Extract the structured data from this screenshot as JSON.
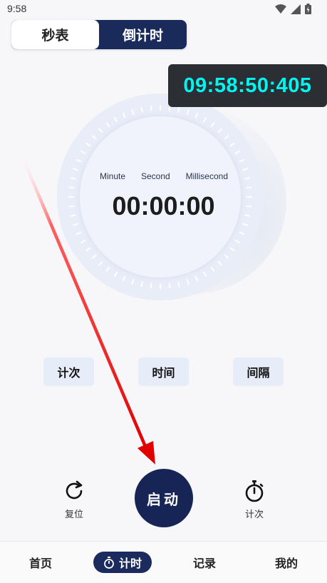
{
  "status": {
    "time": "9:58"
  },
  "tabs": {
    "stopwatch": "秒表",
    "countdown": "倒计时"
  },
  "overlay_clock": "09:58:50:405",
  "dial": {
    "units": [
      "Minute",
      "Second",
      "Millisecond"
    ],
    "readout": "00:00:00"
  },
  "actions": {
    "lap": "计次",
    "time": "时间",
    "interval": "间隔"
  },
  "controls": {
    "reset_label": "复位",
    "start_label": "启动",
    "lap_label": "计次"
  },
  "nav": {
    "home": "首页",
    "timer": "计时",
    "records": "记录",
    "mine": "我的"
  },
  "colors": {
    "accent": "#162556",
    "overlay_text": "#00f5f0",
    "arrow": "#e00000"
  },
  "icons": [
    "wifi-icon",
    "signal-icon",
    "battery-icon",
    "reset-icon",
    "stopwatch-icon",
    "timer-nav-icon",
    "arrow-annotation"
  ]
}
